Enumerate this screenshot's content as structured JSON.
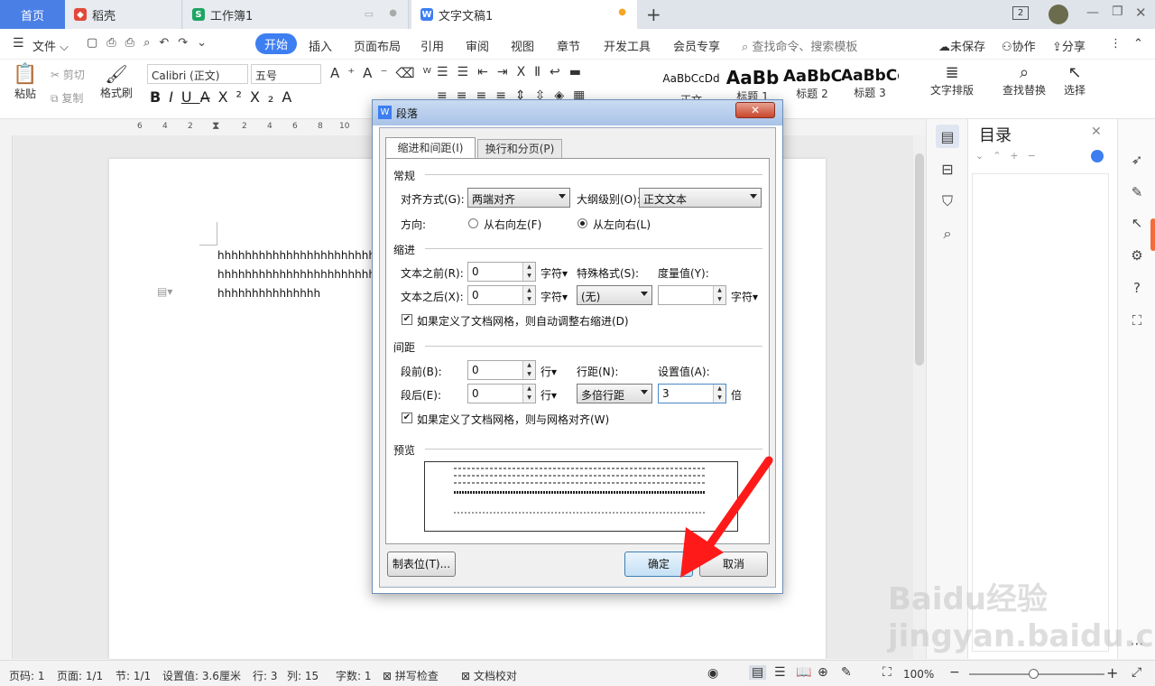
{
  "tabs": {
    "home": "首页",
    "tab1": "稻壳",
    "tab2": "工作簿1",
    "tab3": "文字文稿1",
    "new_tab": "+",
    "window_count": "2"
  },
  "menubar": {
    "file": "文件",
    "items": [
      "开始",
      "插入",
      "页面布局",
      "引用",
      "审阅",
      "视图",
      "章节",
      "开发工具",
      "会员专享"
    ],
    "search_placeholder": "查找命令、搜索模板",
    "unsaved": "未保存",
    "collab": "协作",
    "share": "分享"
  },
  "ribbon": {
    "paste": "粘贴",
    "cut": "剪切",
    "copy": "复制",
    "format_painter": "格式刷",
    "font_name": "Calibri (正文)",
    "font_size": "五号",
    "styles": [
      {
        "preview": "AaBbCcDd",
        "name": "正文"
      },
      {
        "preview": "AaBb",
        "name": "标题 1"
      },
      {
        "preview": "AaBbC",
        "name": "标题 2"
      },
      {
        "preview": "AaBbCc",
        "name": "标题 3"
      }
    ],
    "text_layout": "文字排版",
    "find_replace": "查找替换",
    "select": "选择"
  },
  "ruler_ticks": [
    "6",
    "4",
    "2",
    "2",
    "4",
    "6",
    "8",
    "10"
  ],
  "document": {
    "lines": [
      "hhhhhhhhhhhhhhhhhhhhhhhhhh",
      "hhhhhhhhhhhhhhhhhhhhhhhhhh",
      "hhhhhhhhhhhhhhh"
    ]
  },
  "toc": {
    "title": "目录"
  },
  "dialog": {
    "title": "段落",
    "tab_indent": "缩进和间距(I)",
    "tab_linebreak": "换行和分页(P)",
    "section_general": "常规",
    "align_label": "对齐方式(G):",
    "align_value": "两端对齐",
    "outline_label": "大纲级别(O):",
    "outline_value": "正文文本",
    "direction_label": "方向:",
    "rtl": "从右向左(F)",
    "ltr": "从左向右(L)",
    "section_indent": "缩进",
    "before_text_label": "文本之前(R):",
    "before_text_value": "0",
    "after_text_label": "文本之后(X):",
    "after_text_value": "0",
    "unit_char": "字符",
    "special_label": "特殊格式(S):",
    "special_value": "(无)",
    "measure_label": "度量值(Y):",
    "measure_value": "",
    "auto_indent_check": "如果定义了文档网格，则自动调整右缩进(D)",
    "section_spacing": "间距",
    "before_label": "段前(B):",
    "before_value": "0",
    "after_label": "段后(E):",
    "after_value": "0",
    "unit_line": "行",
    "line_spacing_label": "行距(N):",
    "line_spacing_value": "多倍行距",
    "set_value_label": "设置值(A):",
    "set_value": "3",
    "unit_times": "倍",
    "grid_align_check": "如果定义了文档网格，则与网格对齐(W)",
    "section_preview": "预览",
    "tabs_button": "制表位(T)...",
    "ok": "确定",
    "cancel": "取消"
  },
  "statusbar": {
    "page_num": "页码: 1",
    "pages": "页面: 1/1",
    "section": "节: 1/1",
    "set_value": "设置值: 3.6厘米",
    "row": "行: 3",
    "col": "列: 15",
    "word_count": "字数: 1",
    "spell_check": "拼写检查",
    "doc_check": "文档校对",
    "zoom": "100%"
  },
  "watermark": "Baidu经验 jingyan.baidu.com",
  "colors": {
    "accent": "#3d7ef1",
    "home_tab": "#4a7fe6",
    "arrow": "#ff1a1a"
  }
}
